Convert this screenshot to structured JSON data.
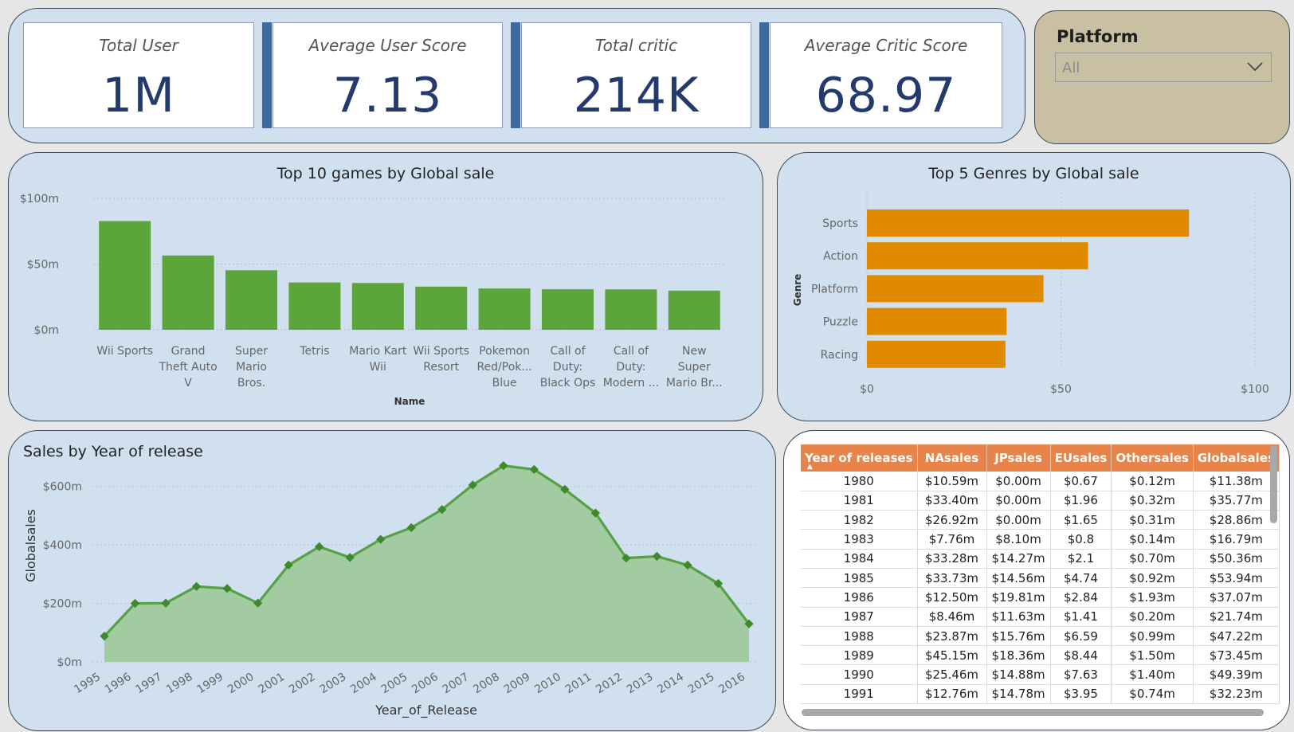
{
  "kpis": [
    {
      "title": "Total User",
      "value": "1M"
    },
    {
      "title": "Average User Score",
      "value": "7.13"
    },
    {
      "title": "Total critic",
      "value": "214K"
    },
    {
      "title": "Average Critic Score",
      "value": "68.97"
    }
  ],
  "slicer": {
    "title": "Platform",
    "value": "All"
  },
  "colors": {
    "bar_green": "#5ba53b",
    "bar_orange": "#e08a00",
    "area_fill": "#a2cba2",
    "line_green": "#55a244",
    "header_orange": "#e8834a",
    "kpi_value": "#243a6e",
    "panel_bg": "#d0e0ef"
  },
  "chart_data": [
    {
      "type": "bar",
      "title": "Top 10 games by Global sale",
      "xlabel": "Name",
      "ylabel": "",
      "categories": [
        "Wii Sports",
        "Grand Theft Auto V",
        "Super Mario Bros.",
        "Tetris",
        "Mario Kart Wii",
        "Wii Sports Resort",
        "Pokemon Red/Pok... Blue",
        "Call of Duty: Black Ops",
        "Call of Duty: Modern ...",
        "New Super Mario Br..."
      ],
      "category_lines": [
        [
          "Wii Sports"
        ],
        [
          "Grand",
          "Theft Auto",
          "V"
        ],
        [
          "Super",
          "Mario",
          "Bros."
        ],
        [
          "Tetris"
        ],
        [
          "Mario Kart",
          "Wii"
        ],
        [
          "Wii Sports",
          "Resort"
        ],
        [
          "Pokemon",
          "Red/Pok...",
          "Blue"
        ],
        [
          "Call of",
          "Duty:",
          "Black Ops"
        ],
        [
          "Call of",
          "Duty:",
          "Modern ..."
        ],
        [
          "New",
          "Super",
          "Mario Br..."
        ]
      ],
      "values": [
        82.7,
        56.5,
        45.3,
        36.0,
        35.6,
        32.8,
        31.4,
        30.8,
        30.7,
        29.8
      ],
      "ylim": [
        0,
        100
      ],
      "yticks": [
        "$0m",
        "$50m",
        "$100m"
      ],
      "grid": true
    },
    {
      "type": "bar",
      "orientation": "horizontal",
      "title": "Top 5 Genres by Global sale",
      "ylabel": "Genre",
      "xlabel": "",
      "categories": [
        "Sports",
        "Action",
        "Platform",
        "Puzzle",
        "Racing"
      ],
      "values": [
        83,
        57,
        45.5,
        36,
        35.7
      ],
      "xlim": [
        0,
        100
      ],
      "xticks": [
        "$0",
        "$50",
        "$100"
      ],
      "grid": true
    },
    {
      "type": "area",
      "title": "Sales by Year of release",
      "xlabel": "Year_of_Release",
      "ylabel": "Globalsales",
      "x": [
        "1995",
        "1996",
        "1997",
        "1998",
        "1999",
        "2000",
        "2001",
        "2002",
        "2003",
        "2004",
        "2005",
        "2006",
        "2007",
        "2008",
        "2009",
        "2010",
        "2011",
        "2012",
        "2013",
        "2014",
        "2015",
        "2016"
      ],
      "values": [
        88,
        200,
        201,
        258,
        251,
        201,
        331,
        394,
        357,
        419,
        459,
        521,
        605,
        671,
        658,
        590,
        509,
        355,
        361,
        331,
        268,
        130
      ],
      "ylim": [
        0,
        640
      ],
      "yticks": [
        "$0m",
        "$200m",
        "$400m",
        "$600m"
      ],
      "grid": true
    },
    {
      "type": "table",
      "columns": [
        "Year of releases",
        "NAsales",
        "JPsales",
        "EUsales",
        "Othersales",
        "Globalsales"
      ],
      "rows": [
        [
          "1980",
          "$10.59m",
          "$0.00m",
          "$0.67",
          "$0.12m",
          "$11.38m"
        ],
        [
          "1981",
          "$33.40m",
          "$0.00m",
          "$1.96",
          "$0.32m",
          "$35.77m"
        ],
        [
          "1982",
          "$26.92m",
          "$0.00m",
          "$1.65",
          "$0.31m",
          "$28.86m"
        ],
        [
          "1983",
          "$7.76m",
          "$8.10m",
          "$0.8",
          "$0.14m",
          "$16.79m"
        ],
        [
          "1984",
          "$33.28m",
          "$14.27m",
          "$2.1",
          "$0.70m",
          "$50.36m"
        ],
        [
          "1985",
          "$33.73m",
          "$14.56m",
          "$4.74",
          "$0.92m",
          "$53.94m"
        ],
        [
          "1986",
          "$12.50m",
          "$19.81m",
          "$2.84",
          "$1.93m",
          "$37.07m"
        ],
        [
          "1987",
          "$8.46m",
          "$11.63m",
          "$1.41",
          "$0.20m",
          "$21.74m"
        ],
        [
          "1988",
          "$23.87m",
          "$15.76m",
          "$6.59",
          "$0.99m",
          "$47.22m"
        ],
        [
          "1989",
          "$45.15m",
          "$18.36m",
          "$8.44",
          "$1.50m",
          "$73.45m"
        ],
        [
          "1990",
          "$25.46m",
          "$14.88m",
          "$7.63",
          "$1.40m",
          "$49.39m"
        ],
        [
          "1991",
          "$12.76m",
          "$14.78m",
          "$3.95",
          "$0.74m",
          "$32.23m"
        ]
      ]
    }
  ]
}
